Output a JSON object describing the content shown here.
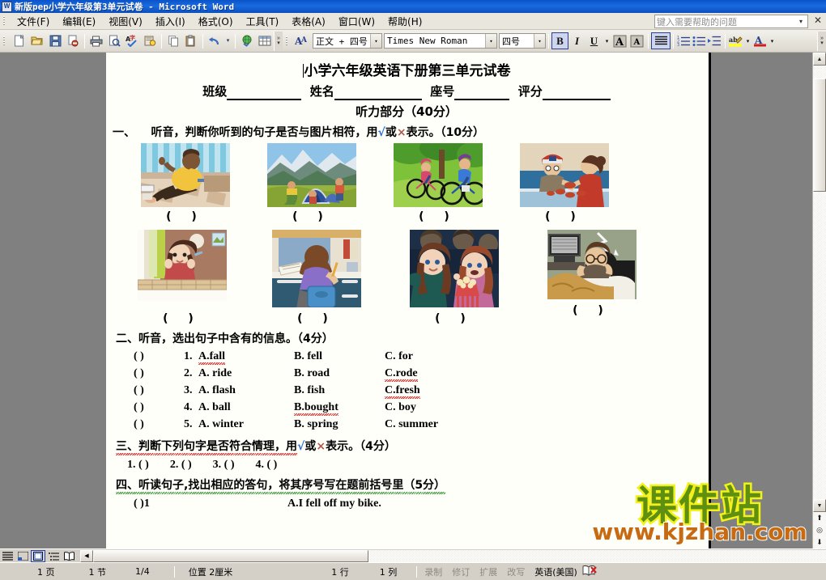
{
  "window": {
    "title": "新版pep小学六年级第3单元试卷 - Microsoft Word",
    "app_icon": "word-document-icon"
  },
  "menubar": {
    "items": [
      {
        "label": "文件(F)",
        "name": "menu-file"
      },
      {
        "label": "编辑(E)",
        "name": "menu-edit"
      },
      {
        "label": "视图(V)",
        "name": "menu-view"
      },
      {
        "label": "插入(I)",
        "name": "menu-insert"
      },
      {
        "label": "格式(O)",
        "name": "menu-format"
      },
      {
        "label": "工具(T)",
        "name": "menu-tools"
      },
      {
        "label": "表格(A)",
        "name": "menu-table"
      },
      {
        "label": "窗口(W)",
        "name": "menu-window"
      },
      {
        "label": "帮助(H)",
        "name": "menu-help"
      }
    ],
    "help_placeholder": "键入需要帮助的问题",
    "close_label": "✕",
    "dropdown_label": "▾"
  },
  "toolbar": {
    "standard": [
      {
        "name": "new-document-icon",
        "glyph": "🗋"
      },
      {
        "name": "open-folder-icon",
        "glyph": "📂"
      },
      {
        "name": "save-icon",
        "glyph": "💾"
      },
      {
        "name": "permission-icon",
        "glyph": "🔏"
      },
      {
        "name": "print-icon",
        "glyph": "🖨"
      },
      {
        "name": "print-preview-icon",
        "glyph": "🔍"
      },
      {
        "name": "spelling-check-icon",
        "glyph": "ABC"
      },
      {
        "name": "research-icon",
        "glyph": "📖"
      },
      {
        "name": "copy-icon",
        "glyph": "⧉"
      },
      {
        "name": "paste-icon",
        "glyph": "📋"
      },
      {
        "name": "undo-icon",
        "glyph": "↰"
      },
      {
        "name": "undo-dropdown-icon",
        "glyph": "▾"
      },
      {
        "name": "insert-hyperlink-icon",
        "glyph": "🌐"
      },
      {
        "name": "insert-table-icon",
        "glyph": "▦"
      }
    ],
    "formatting": {
      "style_combo_label": "正文 + 四号",
      "font_combo_label": "Times New Roman",
      "size_combo_label": "四号",
      "styles_and_formatting_icon": "A4",
      "bold_label": "B",
      "italic_label": "I",
      "underline_label": "U",
      "underline_dropdown": "▾",
      "grow_font_label": "A",
      "shrink_font_label": "A",
      "align_label": "≣",
      "numbering_label": "⒈≡",
      "bullets_label": "•≡",
      "increase_indent_label": "⇥≡",
      "highlight_label": "ab",
      "highlight_dropdown": "▾",
      "font_color_label": "A",
      "font_color_dropdown": "▾"
    }
  },
  "document": {
    "title": "小学六年级英语下册第三单元试卷",
    "fields": [
      {
        "label": "班级",
        "blank_width": 92
      },
      {
        "label": "姓名",
        "blank_width": 108
      },
      {
        "label": "座号",
        "blank_width": 68
      },
      {
        "label": "评分",
        "blank_width": 84
      }
    ],
    "listening_header": "听力部分（40分）",
    "section_one": {
      "marker": "一、",
      "text_before_check": "听音，判断你听到的句子是否与图片相符，用",
      "check_symbol": "√",
      "between": "或",
      "cross_symbol": "×",
      "text_after": "表示。（10分）"
    },
    "image_row_1": [
      {
        "name": "picture-boy-sitting-floor",
        "answer_paren": "(        )"
      },
      {
        "name": "picture-camping-tent",
        "answer_paren": "(        )"
      },
      {
        "name": "picture-cycling",
        "answer_paren": "(        )"
      },
      {
        "name": "picture-buying-fish",
        "answer_paren": "(        )"
      }
    ],
    "image_row_2": [
      {
        "name": "picture-girl-at-window",
        "answer_paren": "(        )"
      },
      {
        "name": "picture-boy-studying-desk",
        "answer_paren": "(        )"
      },
      {
        "name": "picture-girls-cinema-popcorn",
        "answer_paren": "(        )"
      },
      {
        "name": "picture-man-watching-tv-bed",
        "answer_paren": "(        )"
      }
    ],
    "section_two": {
      "heading": "二、听音，选出句子中含有的信息。（4分）",
      "rows": [
        {
          "paren": "(       )",
          "num": "1.",
          "a": "A.fall",
          "a_misspell": true,
          "b": "B. fell",
          "b_misspell": false,
          "c": "C. for",
          "c_misspell": false
        },
        {
          "paren": "(       )",
          "num": "2.",
          "a": "A. ride",
          "a_misspell": false,
          "b": "B. road",
          "b_misspell": false,
          "c": "C.rode",
          "c_misspell": true
        },
        {
          "paren": "(       )",
          "num": "3.",
          "a": "A. flash",
          "a_misspell": false,
          "b": "B. fish",
          "b_misspell": false,
          "c": "C.fresh",
          "c_misspell": true
        },
        {
          "paren": "(       )",
          "num": "4.",
          "a": "A. ball",
          "a_misspell": false,
          "b": "B.bought",
          "b_misspell": true,
          "c": "C. boy",
          "c_misspell": false
        },
        {
          "paren": "(       )",
          "num": "5.",
          "a": "A. winter",
          "a_misspell": false,
          "b": "B. spring",
          "b_misspell": false,
          "c": "C. summer",
          "c_misspell": false
        }
      ]
    },
    "section_three": {
      "heading_before": "三、判断下列句字是否符合情理，用",
      "check_symbol": "√",
      "between": "或",
      "cross_symbol": "×",
      "heading_after": "表示。（4分）",
      "items": [
        "1. (         )",
        "2. (         )",
        "3. (         )",
        "4. (         )"
      ]
    },
    "section_four": {
      "heading": "四、听读句子,找出相应的答句，将其序号写在题前括号里（5分）",
      "first_row_paren": "(    )1",
      "first_row_answer": "A.I fell off my bike."
    }
  },
  "watermark": {
    "chinese": "课件站",
    "url": "www.kjzhan.com"
  },
  "viewbar": {
    "buttons": [
      {
        "name": "view-normal-button",
        "glyph": "≣",
        "selected": false
      },
      {
        "name": "view-web-layout-button",
        "glyph": "◱",
        "selected": false
      },
      {
        "name": "view-print-layout-button",
        "glyph": "▤",
        "selected": true
      },
      {
        "name": "view-outline-button",
        "glyph": "⋮≡",
        "selected": false
      },
      {
        "name": "view-reading-layout-button",
        "glyph": "📖",
        "selected": false
      }
    ]
  },
  "scrollbar": {
    "up_arrow": "▲",
    "down_arrow": "▼",
    "left_arrow": "◀",
    "prev_page_icon": "⬆",
    "select_browse_object_icon": "◎",
    "next_page_icon": "⬇"
  },
  "statusbar": {
    "page_label": "1 页",
    "section_label": "1 节",
    "page_of_label": "1/4",
    "position_label": "位置 2厘米",
    "line_label": "1 行",
    "column_label": "1 列",
    "rec_label": "录制",
    "trk_label": "修订",
    "ext_label": "扩展",
    "ovr_label": "改写",
    "language_label": "英语(美国)",
    "spellcheck_icon": "book-with-x-icon"
  }
}
